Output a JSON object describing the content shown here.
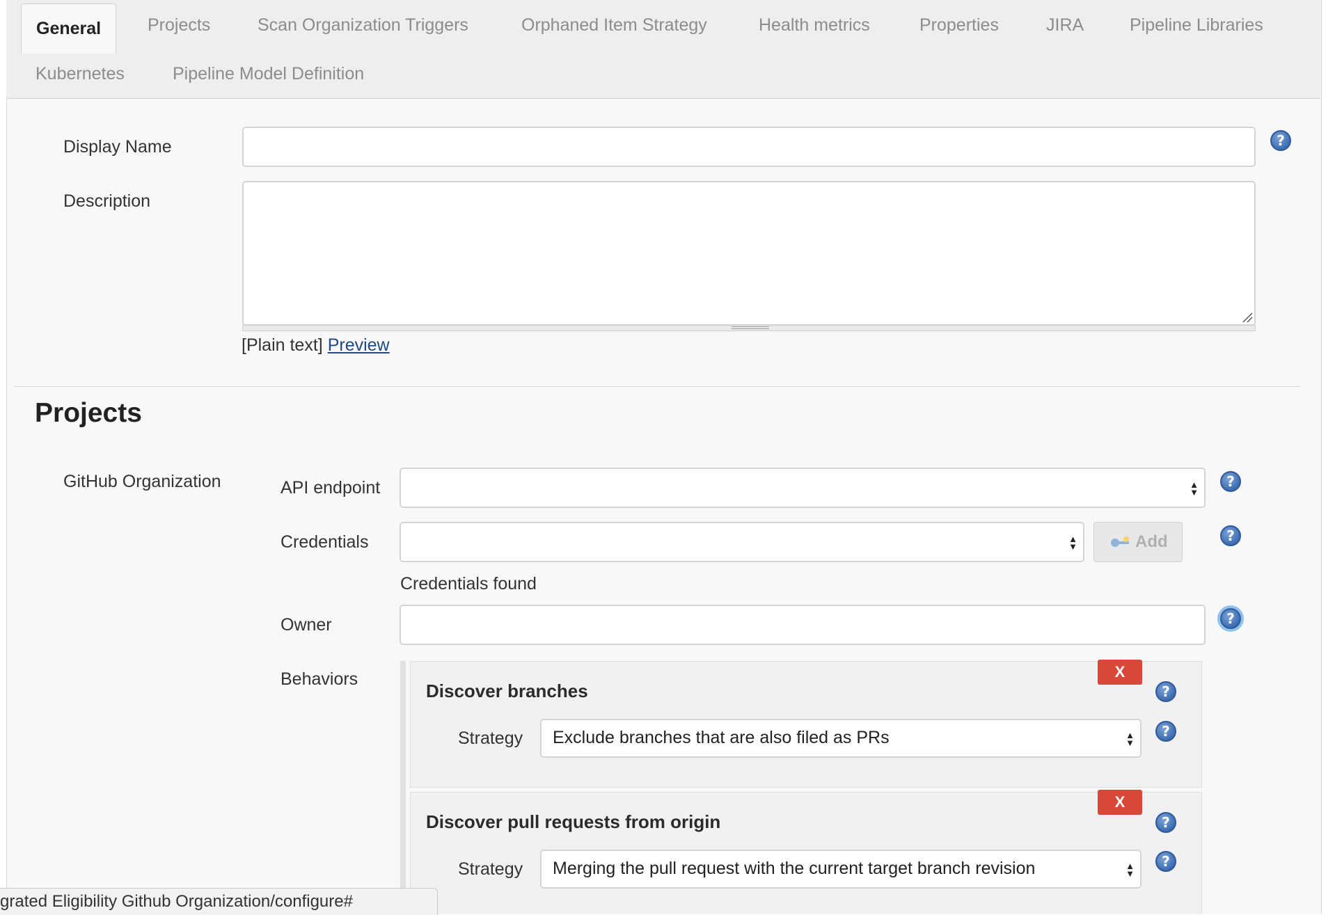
{
  "tabs": [
    {
      "label": "General"
    },
    {
      "label": "Projects"
    },
    {
      "label": "Scan Organization Triggers"
    },
    {
      "label": "Orphaned Item Strategy"
    },
    {
      "label": "Health metrics"
    },
    {
      "label": "Properties"
    },
    {
      "label": "JIRA"
    },
    {
      "label": "Pipeline Libraries"
    },
    {
      "label": "Kubernetes"
    },
    {
      "label": "Pipeline Model Definition"
    }
  ],
  "general": {
    "display_name_label": "Display Name",
    "display_name_value": "",
    "description_label": "Description",
    "description_value": "",
    "format_text": "[Plain text]",
    "preview_link": "Preview"
  },
  "projects": {
    "title": "Projects",
    "source_label": "GitHub Organization",
    "api_endpoint_label": "API endpoint",
    "api_endpoint_value": "",
    "credentials_label": "Credentials",
    "credentials_value": "",
    "add_button": "Add",
    "credentials_status": "Credentials found",
    "owner_label": "Owner",
    "owner_value": "",
    "behaviors_label": "Behaviors",
    "behaviors": [
      {
        "title": "Discover branches",
        "delete_label": "X",
        "strategy_label": "Strategy",
        "strategy_value": "Exclude branches that are also filed as PRs"
      },
      {
        "title": "Discover pull requests from origin",
        "delete_label": "X",
        "strategy_label": "Strategy",
        "strategy_value": "Merging the pull request with the current target branch revision"
      }
    ]
  },
  "status_bar": {
    "url_text": "grated Eligibility Github Organization/configure#"
  },
  "icons": {
    "help": "help-icon",
    "select": "updown-arrows-icon",
    "key": "key-icon"
  },
  "colors": {
    "delete_button": "#d9463a",
    "help_icon": "#3d6db3",
    "link": "#204a87"
  }
}
